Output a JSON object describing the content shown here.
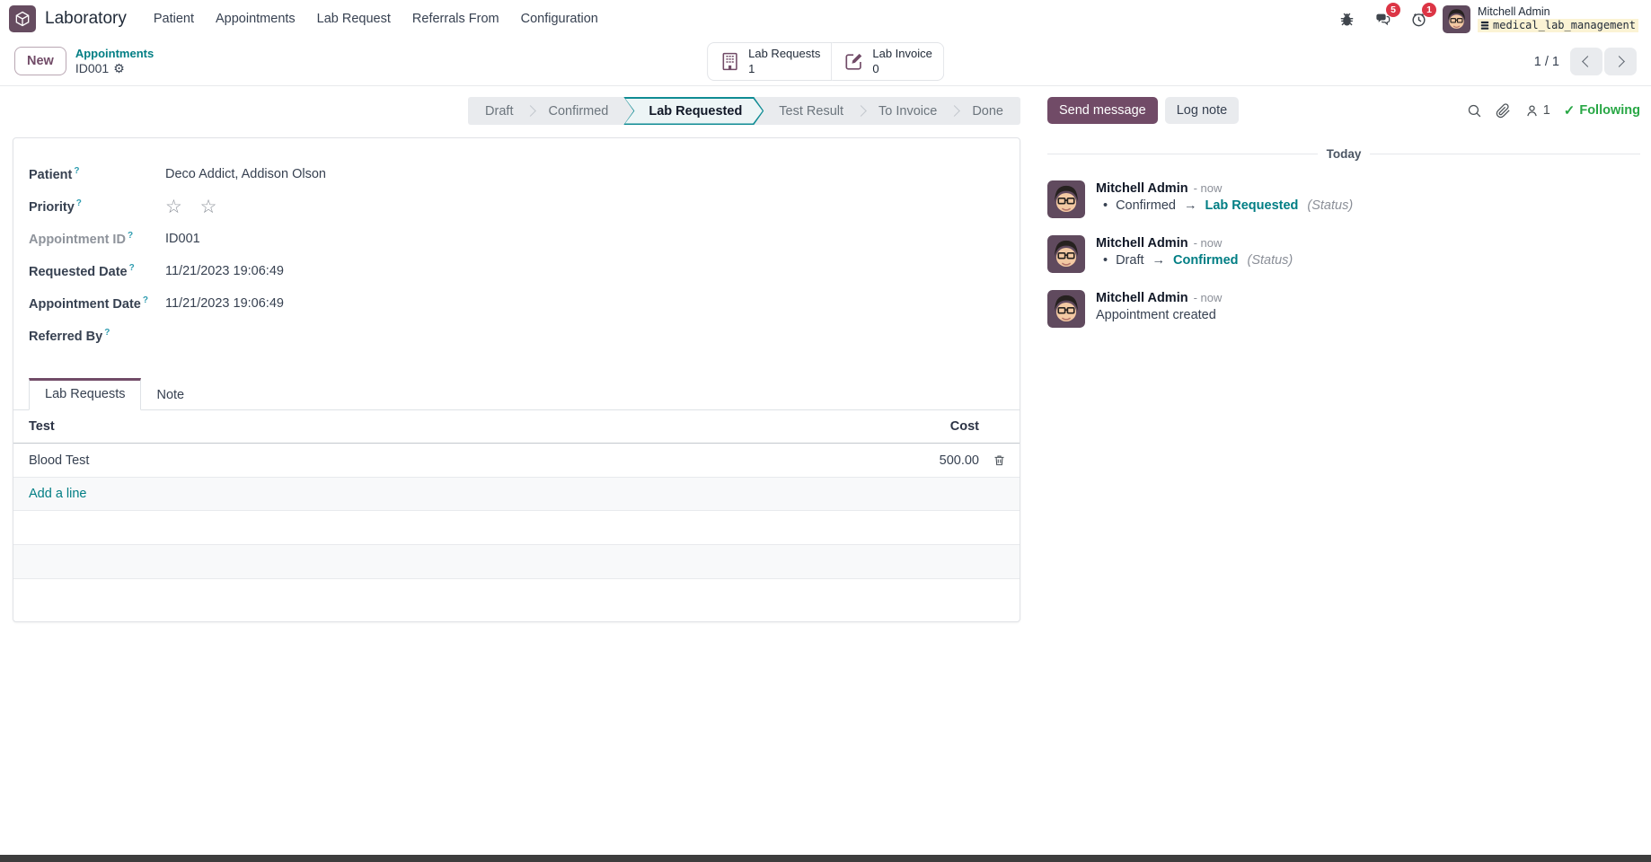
{
  "topbar": {
    "app_name": "Laboratory",
    "menus": [
      "Patient",
      "Appointments",
      "Lab Request",
      "Referrals From",
      "Configuration"
    ],
    "messages_badge": "5",
    "activities_badge": "1",
    "user_name": "Mitchell Admin",
    "database": "medical_lab_management"
  },
  "control_panel": {
    "new_button": "New",
    "breadcrumb_parent": "Appointments",
    "breadcrumb_current": "ID001",
    "pager": "1 / 1",
    "smart_buttons": [
      {
        "label": "Lab Requests",
        "count": "1"
      },
      {
        "label": "Lab Invoice",
        "count": "0"
      }
    ]
  },
  "statusbar": {
    "steps": [
      {
        "label": "Draft",
        "active": false
      },
      {
        "label": "Confirmed",
        "active": false
      },
      {
        "label": "Lab Requested",
        "active": true
      },
      {
        "label": "Test Result",
        "active": false
      },
      {
        "label": "To Invoice",
        "active": false
      },
      {
        "label": "Done",
        "active": false
      }
    ]
  },
  "form": {
    "patient": {
      "label": "Patient",
      "value": "Deco Addict, Addison Olson"
    },
    "priority": {
      "label": "Priority",
      "stars": "☆ ☆"
    },
    "appointment_id": {
      "label": "Appointment ID",
      "value": "ID001"
    },
    "requested_date": {
      "label": "Requested Date",
      "value": "11/21/2023 19:06:49"
    },
    "appointment_date": {
      "label": "Appointment Date",
      "value": "11/21/2023 19:06:49"
    },
    "referred_by": {
      "label": "Referred By",
      "value": ""
    }
  },
  "notebook": {
    "tabs": [
      {
        "label": "Lab Requests",
        "active": true
      },
      {
        "label": "Note",
        "active": false
      }
    ]
  },
  "lab_table": {
    "headers": {
      "test": "Test",
      "cost": "Cost"
    },
    "rows": [
      {
        "test": "Blood Test",
        "cost": "500.00"
      }
    ],
    "add_line": "Add a line"
  },
  "chatter": {
    "send_message": "Send message",
    "log_note": "Log note",
    "followers_count": "1",
    "following_label": "Following",
    "date_divider": "Today",
    "messages": [
      {
        "author": "Mitchell Admin",
        "time": "- now",
        "from": "Confirmed",
        "to": "Lab Requested",
        "suffix": "(Status)"
      },
      {
        "author": "Mitchell Admin",
        "time": "- now",
        "from": "Draft",
        "to": "Confirmed",
        "suffix": "(Status)"
      },
      {
        "author": "Mitchell Admin",
        "time": "- now",
        "body": "Appointment created"
      }
    ]
  },
  "icons": {
    "gear": "⚙",
    "check": "✓",
    "arrow": "→",
    "bullet": "•",
    "help": "?"
  },
  "colors": {
    "accent_purple": "#714B67",
    "link_teal": "#017E84",
    "active_step_border": "#0F8C94",
    "badge_red": "#dc3545",
    "following_green": "#28a745",
    "db_highlight": "#FBF3D4"
  }
}
